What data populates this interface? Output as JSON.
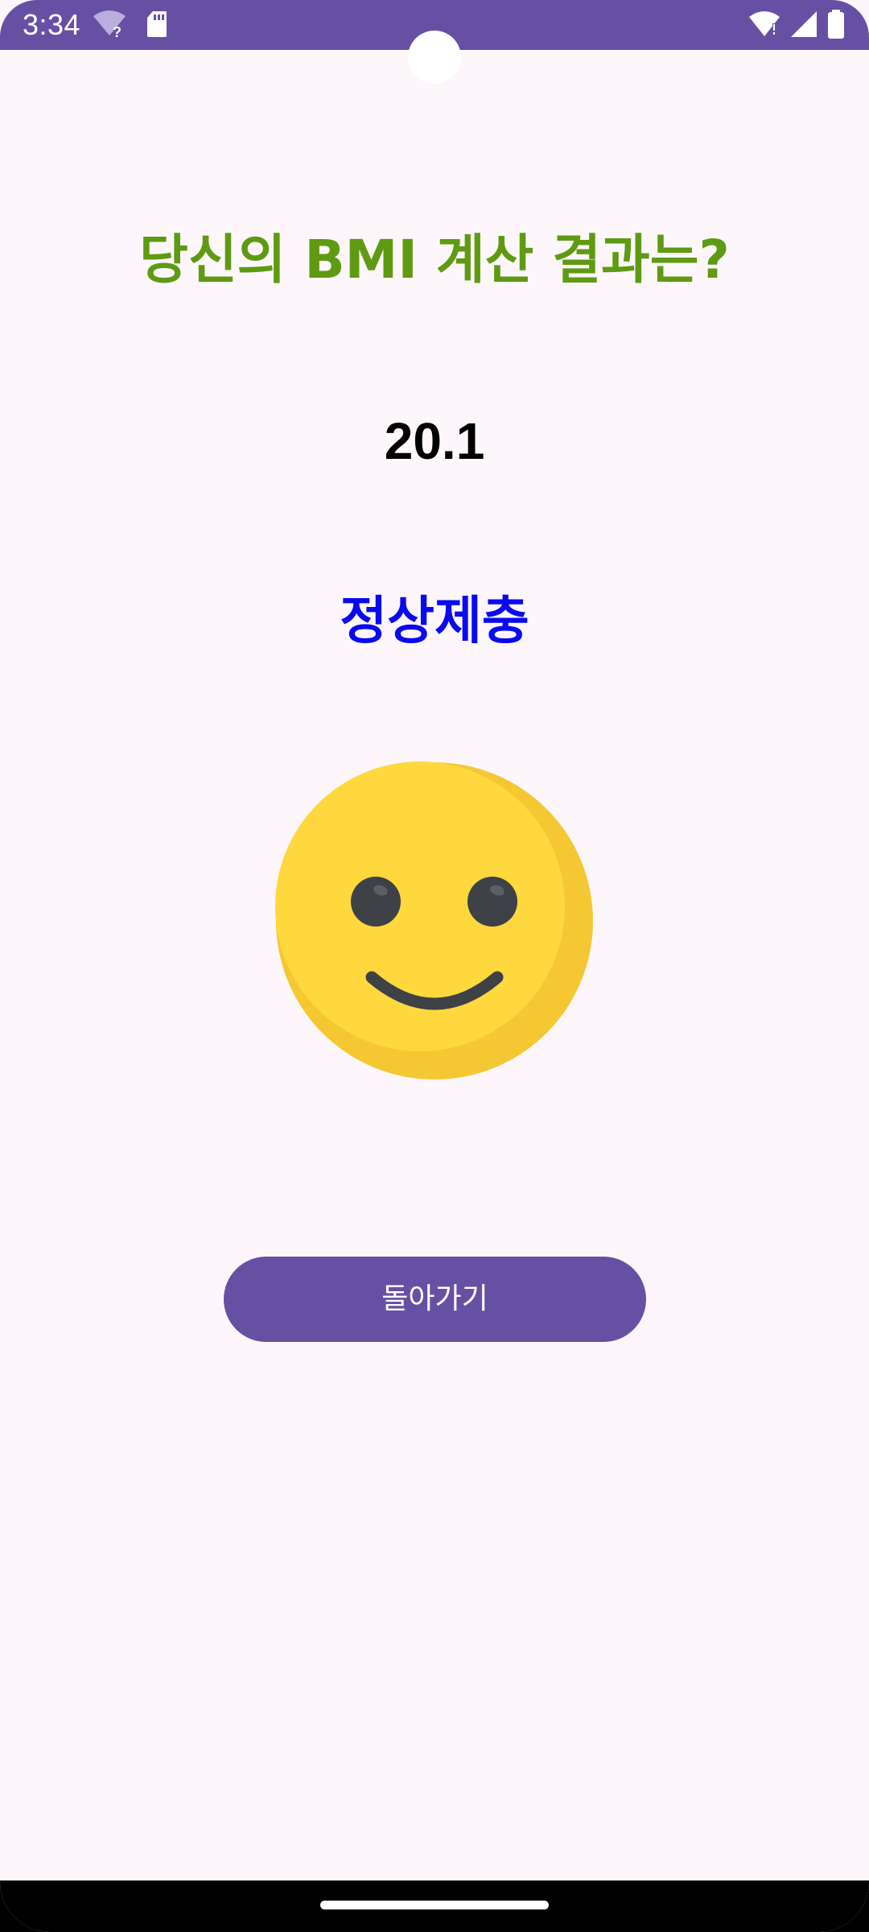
{
  "status_bar": {
    "time": "3:34",
    "icons": [
      "wifi-unknown-icon",
      "sd-card-icon",
      "wifi-signal-icon",
      "cell-signal-icon",
      "battery-icon"
    ],
    "color": "#6750A4"
  },
  "result": {
    "title": "당신의 BMI 계산 결과는?",
    "bmi_value": "20.1",
    "category": "정상제충",
    "emoji": "smiling-face-icon",
    "title_color": "#5E9B12",
    "category_color": "#0A0AF0"
  },
  "actions": {
    "back_label": "돌아가기",
    "button_color": "#6750A4"
  },
  "colors": {
    "background": "#FDF7FC"
  }
}
